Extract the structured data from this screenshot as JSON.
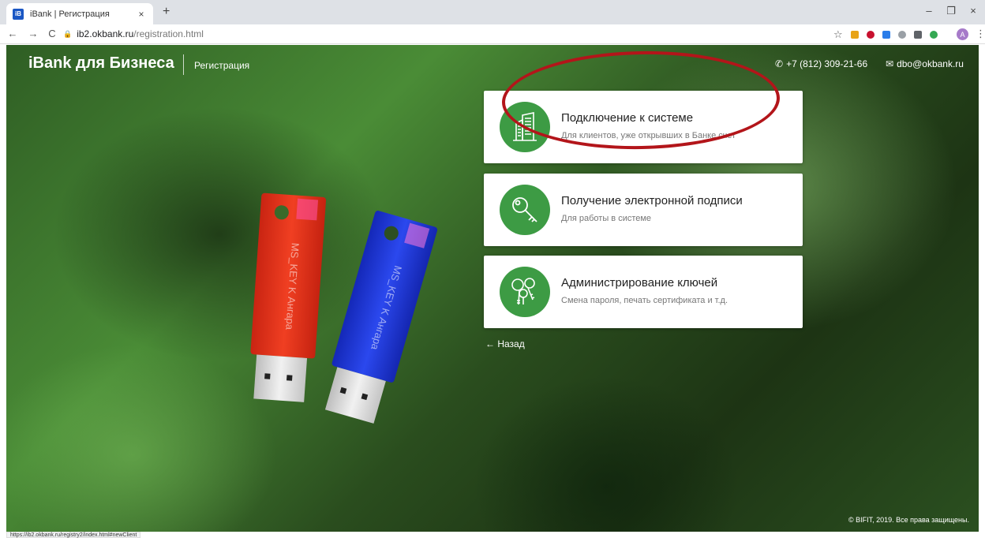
{
  "browser": {
    "tab_title": "iBank | Регистрация",
    "tab_favicon_text": "iB",
    "tab_close": "×",
    "new_tab": "+",
    "window_minimize": "–",
    "window_restore": "❐",
    "window_close": "×",
    "nav_back": "←",
    "nav_forward": "→",
    "nav_reload": "C",
    "url_host": "ib2.okbank.ru",
    "url_path": "/registration.html",
    "avatar_letter": "A",
    "status_bar_url": "https://ib2.okbank.ru/registry2/index.html#newClient"
  },
  "header": {
    "brand": "iBank для Бизнеса",
    "section": "Регистрация",
    "phone": "+7 (812) 309-21-66",
    "email": "dbo@okbank.ru"
  },
  "usb_keys": {
    "red_label": "MS_KEY K Ангара",
    "blue_label": "MS_KEY K Ангара"
  },
  "cards": [
    {
      "title": "Подключение к системе",
      "description": "Для клиентов, уже открывших в Банке счет",
      "icon": "building-icon"
    },
    {
      "title": "Получение электронной подписи",
      "description": "Для работы в системе",
      "icon": "key-icon"
    },
    {
      "title": "Администрирование ключей",
      "description": "Смена пароля, печать сертификата и т.д.",
      "icon": "keys-bunch-icon"
    }
  ],
  "back_link": "← Назад",
  "footer": {
    "copyright": "© BIFIT, 2019. Все права защищены."
  },
  "colors": {
    "icon_circle": "#3d9b44",
    "highlight_ellipse": "#b3151a",
    "usb_red": "#e0321c",
    "usb_blue": "#1c35d6"
  }
}
